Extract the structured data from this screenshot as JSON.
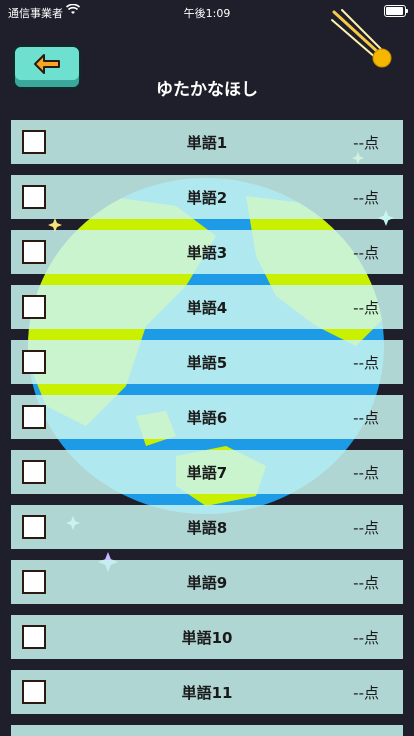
{
  "status_bar": {
    "carrier": "通信事業者",
    "time": "午後1:09"
  },
  "header": {
    "title": "ゆたかなほし"
  },
  "icons": {
    "back": "left-arrow-icon",
    "comet": "comet-icon",
    "checkbox": "empty-checkbox-icon"
  },
  "colors": {
    "background": "#1f1f2b",
    "row": "#c8f5f0",
    "back_button": "#6de0d0",
    "arrow": "#f5a623",
    "globe_ocean": "#1e9be6",
    "globe_land": "#c9f000"
  },
  "words": [
    {
      "label": "単語1",
      "score": "--点"
    },
    {
      "label": "単語2",
      "score": "--点"
    },
    {
      "label": "単語3",
      "score": "--点"
    },
    {
      "label": "単語4",
      "score": "--点"
    },
    {
      "label": "単語5",
      "score": "--点"
    },
    {
      "label": "単語6",
      "score": "--点"
    },
    {
      "label": "単語7",
      "score": "--点"
    },
    {
      "label": "単語8",
      "score": "--点"
    },
    {
      "label": "単語9",
      "score": "--点"
    },
    {
      "label": "単語10",
      "score": "--点"
    },
    {
      "label": "単語11",
      "score": "--点"
    }
  ]
}
